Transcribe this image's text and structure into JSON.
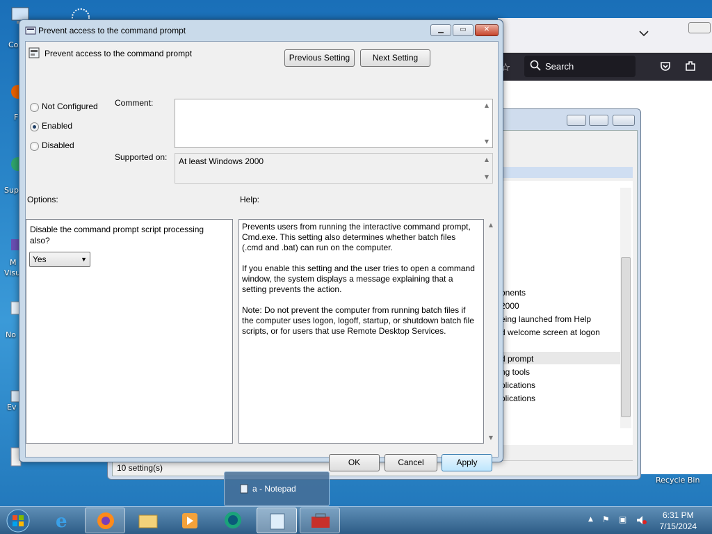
{
  "desktop": {
    "icon_labels": [
      "Co",
      "F",
      "Sup",
      "M",
      "Visu",
      "No",
      "Ev"
    ],
    "recycle_bin": "Recycle Bin"
  },
  "browser": {
    "search_placeholder": "Search"
  },
  "background_window": {
    "status": "10 setting(s)",
    "list_items": [
      "onents",
      "2000",
      "eing launched from Help",
      "d welcome screen at logon",
      "d prompt",
      "ng tools",
      "plications",
      "plications"
    ]
  },
  "dialog": {
    "window_title": "Prevent access to the command prompt",
    "policy_name": "Prevent access to the command prompt",
    "previous_setting": "Previous Setting",
    "next_setting": "Next Setting",
    "radio_not_configured": "Not Configured",
    "radio_enabled": "Enabled",
    "radio_disabled": "Disabled",
    "selected_state": "Enabled",
    "comment_label": "Comment:",
    "comment_value": "",
    "supported_label": "Supported on:",
    "supported_value": "At least Windows 2000",
    "options_label": "Options:",
    "help_label": "Help:",
    "option_text": "Disable the command prompt script processing also?",
    "option_select": "Yes",
    "help_text": "Prevents users from running the interactive command prompt, Cmd.exe. This setting also determines whether batch files (.cmd and .bat) can run on the computer.\n\nIf you enable this setting and the user tries to open a command window, the system displays a message explaining that a setting prevents the action.\n\nNote: Do not prevent the computer from running batch files if the computer uses logon, logoff, startup, or shutdown batch file scripts, or for users that use Remote Desktop Services.",
    "ok": "OK",
    "cancel": "Cancel",
    "apply": "Apply"
  },
  "taskbar": {
    "thumbnail_label": "a - Notepad",
    "time": "6:31 PM",
    "date": "7/15/2024"
  },
  "colors": {
    "accent": "#3c7fb1",
    "dialog_frame": "#c9daea",
    "taskbar": "#2d5c86"
  }
}
